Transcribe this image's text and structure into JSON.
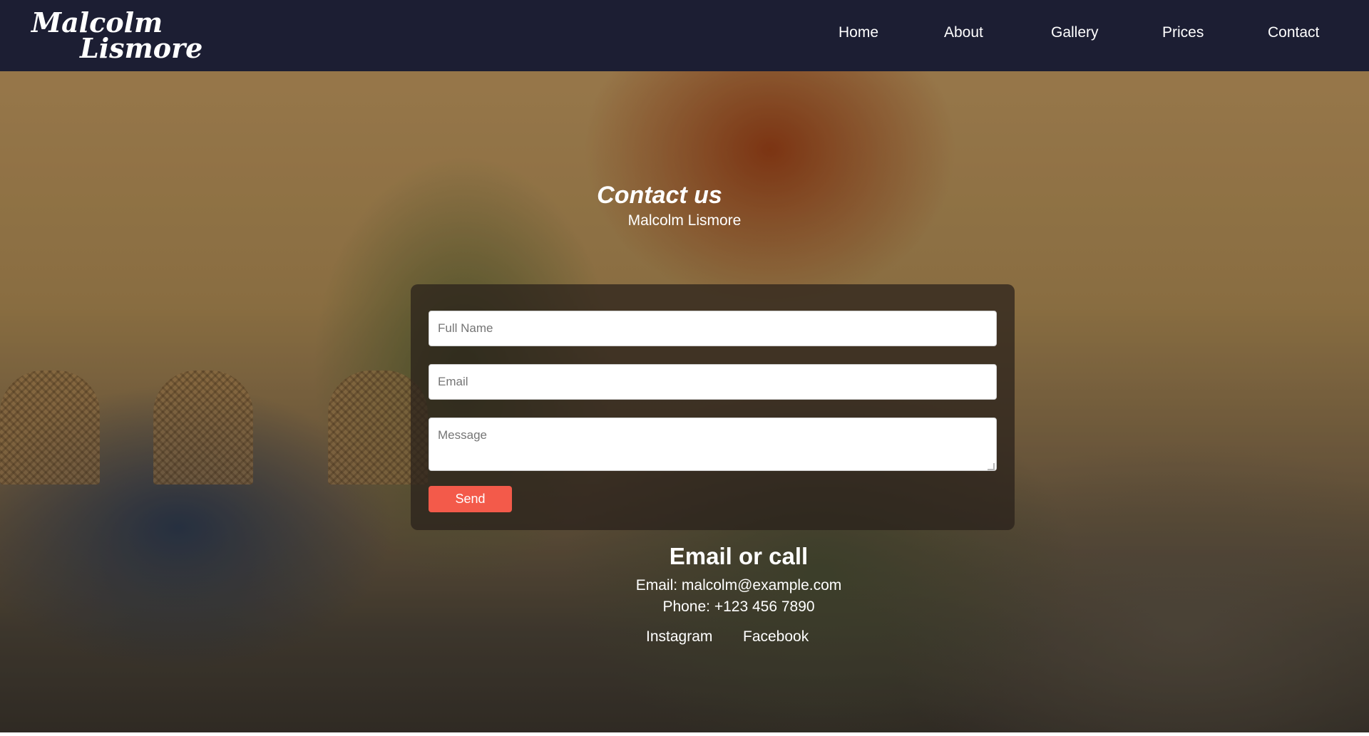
{
  "header": {
    "logo_line1": "Malcolm",
    "logo_line2": "Lismore",
    "nav": [
      "Home",
      "About",
      "Gallery",
      "Prices",
      "Contact"
    ]
  },
  "hero": {
    "title": "Contact us",
    "subtitle": "Malcolm Lismore"
  },
  "form": {
    "name_placeholder": "Full Name",
    "email_placeholder": "Email",
    "message_placeholder": "Message",
    "send_label": "Send",
    "send_color": "#f35a4a"
  },
  "contact": {
    "heading": "Email or call",
    "email_line": "Email: malcolm@example.com",
    "phone_line": "Phone: +123 456 7890",
    "social": [
      "Instagram",
      "Facebook"
    ]
  },
  "colors": {
    "header_bg": "#1c1e33",
    "text": "#ffffff"
  }
}
